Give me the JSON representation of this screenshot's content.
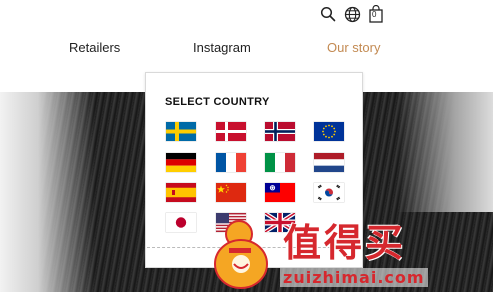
{
  "utility": {
    "search_icon": "search-icon",
    "language_icon": "globe-icon",
    "cart_icon": "shopping-bag-icon",
    "cart_count": "0"
  },
  "nav": {
    "items": [
      {
        "label": "Retailers",
        "active": false
      },
      {
        "label": "Instagram",
        "active": false
      },
      {
        "label": "Our story",
        "active": true
      }
    ],
    "active_color": "#c38a52"
  },
  "country_selector": {
    "title": "SELECT COUNTRY",
    "flags": [
      {
        "country": "Sweden",
        "icon": "flag-sweden-icon"
      },
      {
        "country": "Denmark",
        "icon": "flag-denmark-icon"
      },
      {
        "country": "Norway",
        "icon": "flag-norway-icon"
      },
      {
        "country": "European Union",
        "icon": "flag-eu-icon"
      },
      {
        "country": "Germany",
        "icon": "flag-germany-icon"
      },
      {
        "country": "France",
        "icon": "flag-france-icon"
      },
      {
        "country": "Italy",
        "icon": "flag-italy-icon"
      },
      {
        "country": "Netherlands",
        "icon": "flag-netherlands-icon"
      },
      {
        "country": "Spain",
        "icon": "flag-spain-icon"
      },
      {
        "country": "China",
        "icon": "flag-china-icon"
      },
      {
        "country": "Taiwan",
        "icon": "flag-taiwan-icon"
      },
      {
        "country": "South Korea",
        "icon": "flag-south-korea-icon"
      },
      {
        "country": "Japan",
        "icon": "flag-japan-icon"
      },
      {
        "country": "United States",
        "icon": "flag-usa-icon"
      },
      {
        "country": "United Kingdom",
        "icon": "flag-uk-icon"
      }
    ]
  },
  "watermark": {
    "brand": "值得买",
    "url": "zuizhimai.com"
  }
}
